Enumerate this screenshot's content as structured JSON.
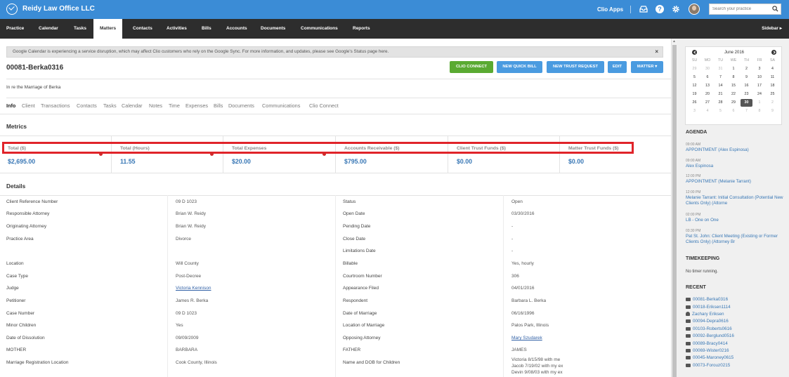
{
  "app": {
    "brand": "Reidy Law Office LLC"
  },
  "header": {
    "apps_label": "Clio Apps",
    "help_label": "?",
    "search_placeholder": "Search your practice"
  },
  "nav": {
    "items": [
      "Practice",
      "Calendar",
      "Tasks",
      "Matters",
      "Contacts",
      "Activities",
      "Bills",
      "Accounts",
      "Documents",
      "Communications",
      "Reports"
    ],
    "active": "Matters",
    "sidebar_toggle": "Sidebar ▸"
  },
  "alert": {
    "text": "Google Calendar is experiencing a service disruption, which may affect Clio customers who rely on the Google Sync. For more information, and updates, please see Google's Status page here.",
    "close": "×"
  },
  "matter": {
    "id": "00081-Berka0316",
    "description": "In re the Marriage of Berka",
    "actions": [
      "CLIO CONNECT",
      "NEW QUICK BILL",
      "NEW TRUST REQUEST",
      "EDIT",
      "MATTER ▾"
    ]
  },
  "tabs": [
    "Info",
    "Client",
    "Transactions",
    "Contacts",
    "Tasks",
    "Calendar",
    "Notes",
    "Time",
    "Expenses",
    "Bills",
    "Documents",
    "Communications",
    "Clio Connect"
  ],
  "metrics": {
    "title": "Metrics",
    "items": [
      {
        "label": "Total ($)",
        "value": "$2,695.00"
      },
      {
        "label": "Total (Hours)",
        "value": "11.55"
      },
      {
        "label": "Total Expenses",
        "value": "$20.00"
      },
      {
        "label": "Accounts Receivable ($)",
        "value": "$795.00"
      },
      {
        "label": "Client Trust Funds ($)",
        "value": "$0.00"
      },
      {
        "label": "Matter Trust Funds ($)",
        "value": "$0.00"
      }
    ]
  },
  "details": {
    "title": "Details",
    "left": [
      {
        "label": "Client Reference Number",
        "value": "09 D 1023"
      },
      {
        "label": "Responsible Attorney",
        "value": "Brian W. Reidy"
      },
      {
        "label": "Originating Attorney",
        "value": "Brian W. Reidy"
      },
      {
        "label": "Practice Area",
        "value": "Divorce"
      },
      {
        "label": "Location",
        "value": "Will County"
      },
      {
        "label": "Case Type",
        "value": "Post-Decree"
      },
      {
        "label": "Judge",
        "value": "Victoria Kennison"
      },
      {
        "label": "Petitioner",
        "value": "James R. Berka"
      },
      {
        "label": "Case Number",
        "value": "09 D 1023"
      },
      {
        "label": "Minor Children",
        "value": "Yes"
      },
      {
        "label": "Date of Dissolution",
        "value": "09/09/2009"
      },
      {
        "label": "MOTHER",
        "value": "BARBARA"
      },
      {
        "label": "Marriage Registration Location",
        "value": "Cook County, Illinois"
      }
    ],
    "right": [
      {
        "label": "Status",
        "value": "Open"
      },
      {
        "label": "Open Date",
        "value": "03/30/2016"
      },
      {
        "label": "Pending Date",
        "value": "-"
      },
      {
        "label": "Close Date",
        "value": "-"
      },
      {
        "label": "Limitations Date",
        "value": "-"
      },
      {
        "label": "Billable",
        "value": "Yes, hourly"
      },
      {
        "label": "Courtroom Number",
        "value": "306"
      },
      {
        "label": "Appearance Filed",
        "value": "04/01/2016"
      },
      {
        "label": "Respondent",
        "value": "Barbara L. Berka"
      },
      {
        "label": "Date of Marriage",
        "value": "06/16/1996"
      },
      {
        "label": "Location of Marriage",
        "value": "Palos Park, Illinois"
      },
      {
        "label": "Opposing Attorney",
        "value": "Mary Szudarek"
      },
      {
        "label": "FATHER",
        "value": "JAMES"
      },
      {
        "label": "Name and DOB for Children",
        "value": "Victoria 8/15/98 with me"
      },
      {
        "label": "",
        "value": "Jacob 7/19/02 with my ex"
      },
      {
        "label": "",
        "value": "Devin 9/08/03 with my ex"
      }
    ]
  },
  "calendar": {
    "month": "June 2016",
    "dow": [
      "SU",
      "MO",
      "TU",
      "WE",
      "TH",
      "FR",
      "SA"
    ],
    "weeks": [
      [
        "29",
        "30",
        "31",
        "1",
        "2",
        "3",
        "4"
      ],
      [
        "5",
        "6",
        "7",
        "8",
        "9",
        "10",
        "11"
      ],
      [
        "12",
        "13",
        "14",
        "15",
        "16",
        "17",
        "18"
      ],
      [
        "19",
        "20",
        "21",
        "22",
        "23",
        "24",
        "25"
      ],
      [
        "26",
        "27",
        "28",
        "29",
        "30",
        "1",
        "2"
      ],
      [
        "3",
        "4",
        "5",
        "6",
        "7",
        "8",
        "9"
      ]
    ],
    "today": "30"
  },
  "agenda": {
    "title": "AGENDA",
    "items": [
      {
        "time": "09:00 AM",
        "text": "APPOINTMENT (Alex Espinosa)"
      },
      {
        "time": "09:00 AM",
        "text": "Alex Espinosa"
      },
      {
        "time": "12:00 PM",
        "text": "APPOINTMENT (Melanie Tarrant)"
      },
      {
        "time": "12:00 PM",
        "text": "Melanie Tarrant: Initial Consultation (Potential New Clients Only) (Attorne"
      },
      {
        "time": "02:00 PM",
        "text": "LB - One on One"
      },
      {
        "time": "03:30 PM",
        "text": "Pat St. John: Client Meeting (Existing or Former Clients Only) (Attorney Br"
      }
    ]
  },
  "timekeeping": {
    "title": "TIMEKEEPING",
    "text": "No timer running."
  },
  "recent": {
    "title": "RECENT",
    "items": [
      {
        "text": "00081-Berka0316",
        "kind": "matter"
      },
      {
        "text": "00018-Eriksen1114",
        "kind": "matter"
      },
      {
        "text": "Zachary Eriksen",
        "kind": "person"
      },
      {
        "text": "00094-Depra0616",
        "kind": "matter"
      },
      {
        "text": "00103-Roberts0616",
        "kind": "matter"
      },
      {
        "text": "00092-Berglund0516",
        "kind": "matter"
      },
      {
        "text": "00089-Bracy0414",
        "kind": "matter"
      },
      {
        "text": "00069-Wister0216",
        "kind": "matter"
      },
      {
        "text": "00045-Maroney0615",
        "kind": "matter"
      },
      {
        "text": "00073-Forouz0215",
        "kind": "matter"
      }
    ]
  },
  "colors": {
    "brand_blue": "#3b8cd6",
    "nav_dark": "#2d2d2d",
    "highlight_red": "#e0242a",
    "action_green": "#5aaa32",
    "link_blue": "#3877b5"
  }
}
